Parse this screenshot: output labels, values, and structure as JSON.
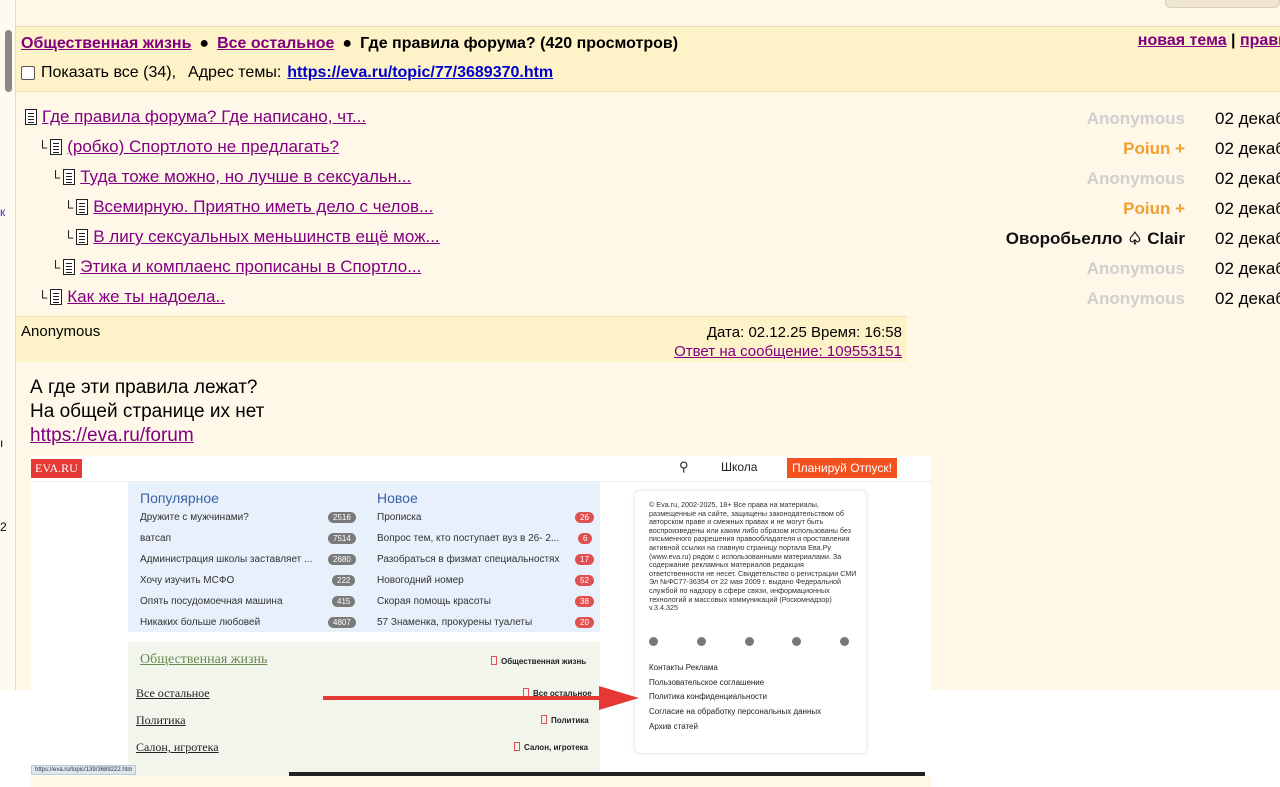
{
  "topic_bar": {
    "crumb1": "Общественная жизнь",
    "crumb2": "Все остальное",
    "topic_title": "Где правила форума? (420 просмотров)",
    "new_topic": "новая тема",
    "sep": "|",
    "rules": "прави",
    "show_all": "Показать все (34),",
    "address_label": "Адрес темы:",
    "address_url": "https://eva.ru/topic/77/3689370.htm"
  },
  "tree": [
    {
      "title": "Где правила форума? Где написано, чт...",
      "author": "Anonymous",
      "date": "02 декаб"
    },
    {
      "title": "(робко) Спортлото не предлагать?",
      "author": "Poiun +",
      "date": "02 декаб"
    },
    {
      "title": "Туда тоже можно, но лучше в сексуальн...",
      "author": "Anonymous",
      "date": "02 декаб"
    },
    {
      "title": "Всемирную. Приятно иметь дело с челов...",
      "author": "Poiun +",
      "date": "02 декаб"
    },
    {
      "title": "В лигу сексуальных меньшинств ещё мож...",
      "author": "Оворобьелло ♤ Clair",
      "date": "02 декаб"
    },
    {
      "title": "Этика и комплаенс прописаны в Спортло...",
      "author": "Anonymous",
      "date": "02 декаб"
    },
    {
      "title": "Как же ты надоела..",
      "author": "Anonymous",
      "date": "02 декаб"
    }
  ],
  "message": {
    "author": "Anonymous",
    "datetime": "Дата: 02.12.25 Время: 16:58",
    "reply_to": "Ответ на сообщение: 109553151",
    "line1": "А где эти правила лежат?",
    "line2": "На общей странице их нет",
    "link": "https://eva.ru/forum"
  },
  "screenshot": {
    "logo": "EVA.RU",
    "school": "Школа",
    "plan": "Планируй Отпуск!",
    "popular_h": "Популярное",
    "new_h": "Новое",
    "popular": [
      {
        "t": "Дружите с мужчинами?",
        "n": "2516"
      },
      {
        "t": "ватсап",
        "n": "7514"
      },
      {
        "t": "Администрация школы заставляет ...",
        "n": "2680"
      },
      {
        "t": "Хочу изучить МСФО",
        "n": "222"
      },
      {
        "t": "Опять посудомоечная машина",
        "n": "415"
      },
      {
        "t": "Никаких больше любовей",
        "n": "4807"
      }
    ],
    "newest": [
      {
        "t": "Прописка",
        "n": "26"
      },
      {
        "t": "Вопрос тем, кто поступает вуз в 26- 2...",
        "n": "6"
      },
      {
        "t": "Разобраться в физмат специальностях",
        "n": "17"
      },
      {
        "t": "Новогодний номер",
        "n": "52"
      },
      {
        "t": "Скорая помощь красоты",
        "n": "38"
      },
      {
        "t": "57 Знаменка, прокурены туалеты",
        "n": "20"
      }
    ],
    "cat_h": "Общественная жизнь",
    "cat_h_tag": "Общественная жизнь",
    "cats": [
      {
        "t": "Все остальное",
        "tag": "Все остальное"
      },
      {
        "t": "Политика",
        "tag": "Политика"
      },
      {
        "t": "Салон, игротека",
        "tag": "Салон, игротека"
      }
    ],
    "legal": "© Eva.ru, 2002-2025, 18+ Все права на материалы, размещенные на сайте, защищены законодательством об авторском праве и смежных правах и не могут быть воспроизведены или каким либо образом использованы без письменного разрешения правообладателя и проставления активной ссылки на главную страницу портала Ева.Ру (www.eva.ru) рядом с использованными материалами. За содержание рекламных материалов редакция ответственности не несет. Свидетельство о регистрации СМИ Эл №ФС77-36354 от 22 мая 2009 г. выдано Федеральной службой по надзору в сфере связи, информационных технологий и массовых коммуникаций (Роскомнадзор) v.3.4.325",
    "footer": [
      "Контакты  Реклама",
      "Пользовательское соглашение",
      "Политика конфиденциальности",
      "Согласие на обработку персональных данных",
      "Архив статей"
    ],
    "status_url": "https://eva.ru/topic/139/3689222.htm"
  }
}
